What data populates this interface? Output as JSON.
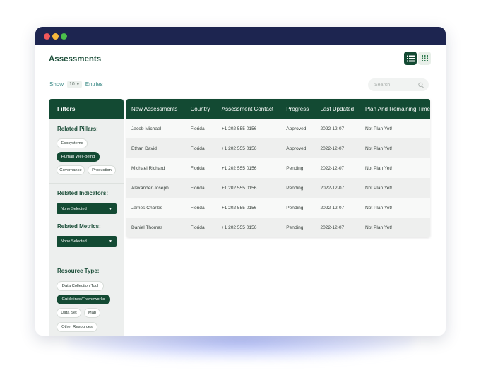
{
  "page": {
    "title": "Assessments"
  },
  "toolbar": {
    "show_label": "Show",
    "entries_value": "10",
    "entries_label": "Entries",
    "search_placeholder": "Search",
    "view_modes": [
      "list-view-icon",
      "grid-view-icon"
    ],
    "active_view": "list"
  },
  "filters": {
    "header": "Filters",
    "related_pillars": {
      "label": "Related Pillars:",
      "chips": [
        {
          "label": "Ecosystems",
          "selected": false
        },
        {
          "label": "Human Well-being",
          "selected": true
        },
        {
          "label": "Governance",
          "selected": false
        },
        {
          "label": "Production",
          "selected": false
        }
      ]
    },
    "related_indicators": {
      "label": "Related Indicators:",
      "value": "None Selected"
    },
    "related_metrics": {
      "label": "Related Metrics:",
      "value": "None Selected"
    },
    "resource_type": {
      "label": "Resource Type:",
      "chips": [
        {
          "label": "Data Collection Tool",
          "selected": false
        },
        {
          "label": "Guidelines/Frameworks",
          "selected": true
        },
        {
          "label": "Data Set",
          "selected": false
        },
        {
          "label": "Map",
          "selected": false
        },
        {
          "label": "Other Resources",
          "selected": false
        }
      ]
    }
  },
  "table": {
    "columns": [
      "New Assessments",
      "Country",
      "Assessment Contact",
      "Progress",
      "Last Updated",
      "Plan And Remaining Time"
    ],
    "rows": [
      [
        "Jacob Michael",
        "Florida",
        "+1 202 555 0156",
        "Approved",
        "2022-12-07",
        "Not Plan Yet!"
      ],
      [
        "Ethan David",
        "Florida",
        "+1 202 555 0156",
        "Approved",
        "2022-12-07",
        "Not Plan Yet!"
      ],
      [
        "Michael Richard",
        "Florida",
        "+1 202 555 0156",
        "Pending",
        "2022-12-07",
        "Not Plan Yet!"
      ],
      [
        "Alexander Joseph",
        "Florida",
        "+1 202 555 0156",
        "Pending",
        "2022-12-07",
        "Not Plan Yet!"
      ],
      [
        "James Charles",
        "Florida",
        "+1 202 555 0156",
        "Pending",
        "2022-12-07",
        "Not Plan Yet!"
      ],
      [
        "Daniel Thomas",
        "Florida",
        "+1 202 555 0156",
        "Pending",
        "2022-12-07",
        "Not Plan Yet!"
      ]
    ]
  },
  "colors": {
    "window_bar": "#1d2550",
    "brand_green": "#134a33",
    "accent_teal": "#3b8a86"
  }
}
